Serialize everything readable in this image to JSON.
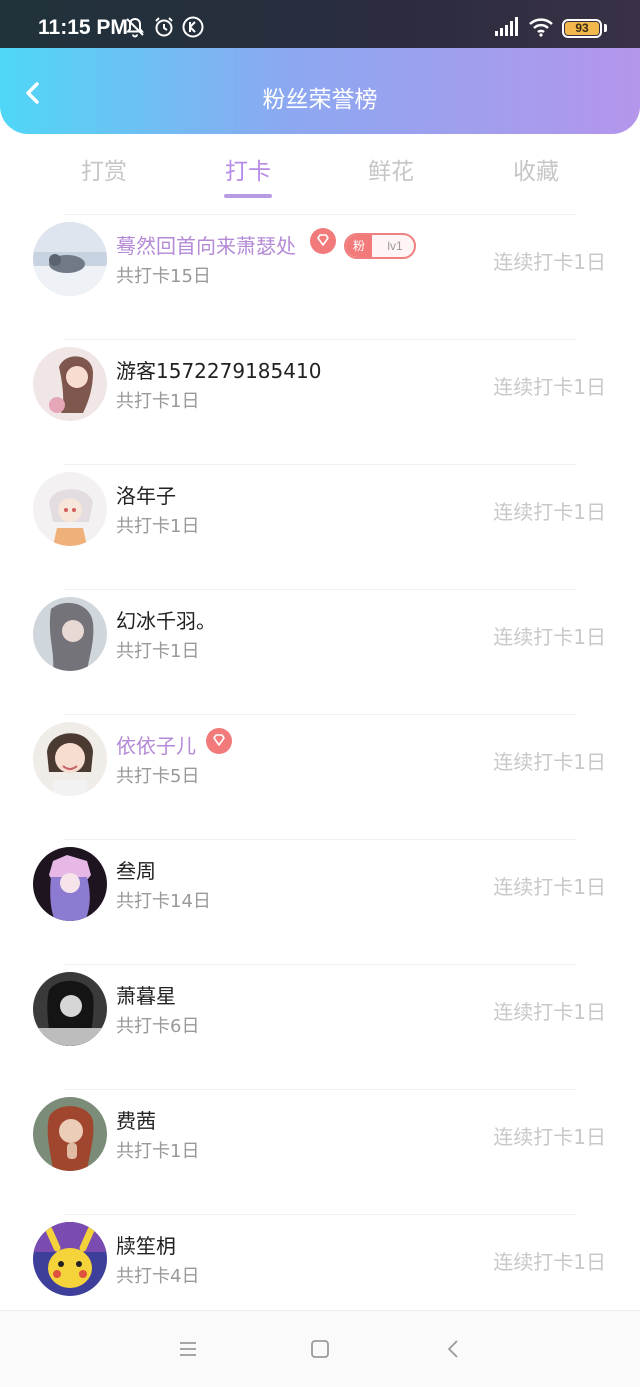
{
  "status_bar": {
    "time": "11:15 PM",
    "battery": "93",
    "icons": [
      "bell-off-icon",
      "alarm-icon",
      "k-icon",
      "signal-icon",
      "wifi-icon",
      "battery-icon"
    ]
  },
  "header": {
    "title": "粉丝荣誉榜",
    "gradient_start": "#4fd7f6",
    "gradient_end": "#b496eb"
  },
  "tabs": [
    {
      "label": "打赏",
      "active": false
    },
    {
      "label": "打卡",
      "active": true
    },
    {
      "label": "鲜花",
      "active": false
    },
    {
      "label": "收藏",
      "active": false
    }
  ],
  "accent_color": "#b78be8",
  "list": [
    {
      "name": "蓦然回首向来萧瑟处",
      "vip": true,
      "fan_badge": {
        "prefix": "粉",
        "level": "lv1"
      },
      "total": "共打卡15日",
      "streak": "连续打卡1日",
      "avatar_hint": "seal-on-snow"
    },
    {
      "name": "游客1572279185410",
      "vip": false,
      "total": "共打卡1日",
      "streak": "连续打卡1日",
      "avatar_hint": "girl-pink"
    },
    {
      "name": "洛年子",
      "vip": false,
      "total": "共打卡1日",
      "streak": "连续打卡1日",
      "avatar_hint": "anime-girl"
    },
    {
      "name": "幻冰千羽。",
      "vip": false,
      "total": "共打卡1日",
      "streak": "连续打卡1日",
      "avatar_hint": "girl-soft"
    },
    {
      "name": "依依子儿",
      "vip": true,
      "total": "共打卡5日",
      "streak": "连续打卡1日",
      "avatar_hint": "child"
    },
    {
      "name": "叁周",
      "vip": false,
      "total": "共打卡14日",
      "streak": "连续打卡1日",
      "avatar_hint": "anime-purple"
    },
    {
      "name": "萧暮星",
      "vip": false,
      "total": "共打卡6日",
      "streak": "连续打卡1日",
      "avatar_hint": "girl-bw"
    },
    {
      "name": "费茜",
      "vip": false,
      "total": "共打卡1日",
      "streak": "连续打卡1日",
      "avatar_hint": "girl-redhair"
    },
    {
      "name": "牍笙枂",
      "vip": false,
      "total": "共打卡4日",
      "streak": "连续打卡1日",
      "avatar_hint": "pikachu"
    }
  ],
  "bottom_nav": [
    "menu-icon",
    "home-square-icon",
    "back-triangle-icon"
  ]
}
